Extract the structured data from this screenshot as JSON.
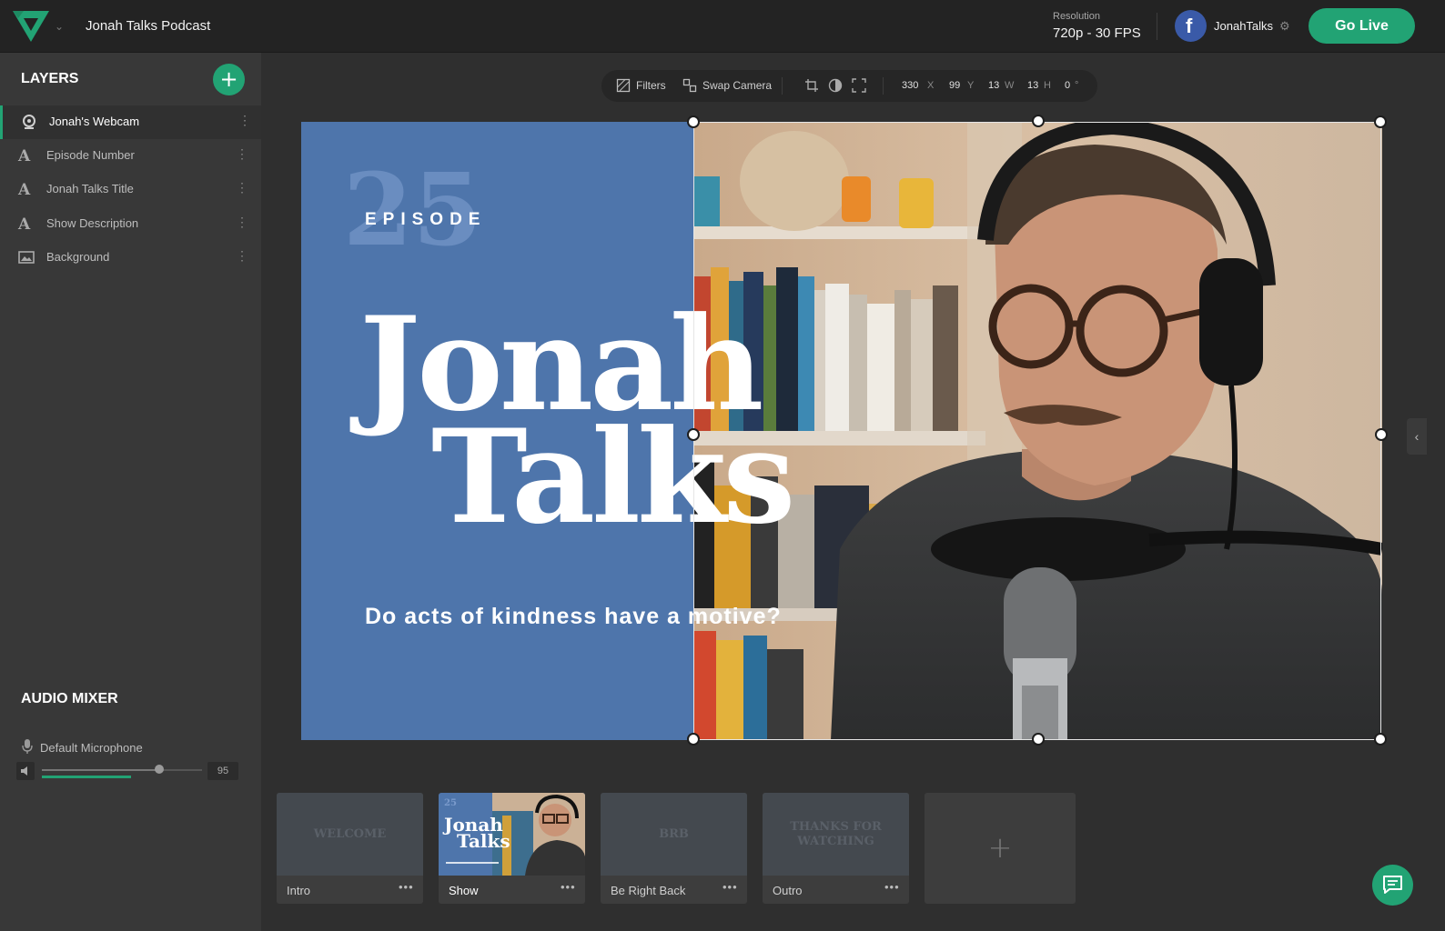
{
  "app": {
    "project_title": "Jonah Talks Podcast",
    "resolution_label": "Resolution",
    "resolution_value": "720p - 30 FPS",
    "account_name": "JonahTalks",
    "account_platform_icon": "facebook-icon",
    "go_live_label": "Go Live",
    "accent_color": "#22a374"
  },
  "sidebar": {
    "layers_title": "LAYERS",
    "layers": [
      {
        "label": "Jonah's Webcam",
        "icon": "webcam-icon",
        "active": true
      },
      {
        "label": "Episode Number",
        "icon": "text-icon",
        "active": false
      },
      {
        "label": "Jonah Talks Title",
        "icon": "text-icon",
        "active": false
      },
      {
        "label": "Show Description",
        "icon": "text-icon",
        "active": false
      },
      {
        "label": "Background",
        "icon": "image-icon",
        "active": false
      }
    ],
    "mixer_title": "AUDIO MIXER",
    "mic_label": "Default Microphone",
    "mic_volume": "95"
  },
  "toolbar": {
    "filters_label": "Filters",
    "swap_label": "Swap Camera",
    "x_value": "330",
    "x_unit": "X",
    "y_value": "99",
    "y_unit": "Y",
    "w_value": "13",
    "w_unit": "W",
    "h_value": "13",
    "h_unit": "H",
    "r_value": "0",
    "r_unit": "°"
  },
  "canvas": {
    "episode_number": "25",
    "episode_label": "EPISODE",
    "title_line1": "Jonah",
    "title_line2": "Talks",
    "description": "Do acts of kindness have a motive?"
  },
  "scenes": [
    {
      "label": "Intro",
      "thumb_text": "WELCOME",
      "active": false
    },
    {
      "label": "Show",
      "thumb_text": "",
      "active": true
    },
    {
      "label": "Be Right Back",
      "thumb_text": "BRB",
      "active": false
    },
    {
      "label": "Outro",
      "thumb_text": "THANKS FOR WATCHING",
      "active": false
    }
  ],
  "scene_more_label": "•••",
  "scene_add_label": "+"
}
